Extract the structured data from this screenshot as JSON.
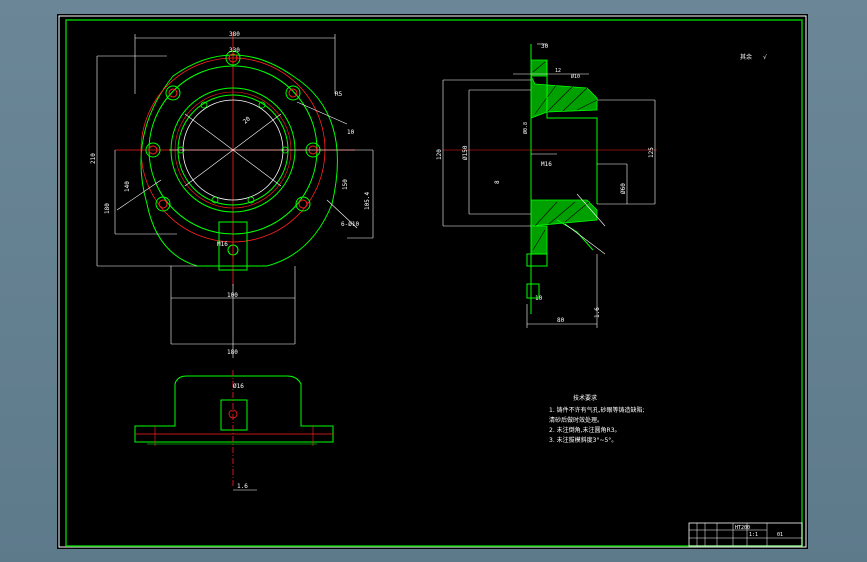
{
  "sheet": {
    "colors": {
      "background": "#000000",
      "frame": "#ffffff",
      "border": "#00c000",
      "outline": "#00ff00",
      "center_line": "#ff2020",
      "dimension": "#ffffff",
      "hatch": "#00c000"
    }
  },
  "roughness": {
    "label": "其余",
    "symbol": "√"
  },
  "plan_view": {
    "dims": [
      "380",
      "330",
      "R5",
      "210",
      "180",
      "140",
      "10",
      "105.4",
      "M16",
      "20",
      "100",
      "150",
      "180",
      "6-Ø10"
    ]
  },
  "bottom_view": {
    "dims": [
      "Ø16",
      "1.6"
    ]
  },
  "section_view": {
    "dims": [
      "30",
      "12",
      "Ø10",
      "120",
      "Ø0.8",
      "Ø150",
      "125",
      "Ø60",
      "M16",
      "8",
      "80",
      "1.6",
      "10"
    ]
  },
  "technical_requirements": {
    "title": "技术要求",
    "items": [
      "1. 铸件不许有气孔,砂眼等铸造缺陷;",
      "   清砂后做时效处理。",
      "2. 未注倒角,未注圆角R3。",
      "3. 未注拔模斜度3°~5°。"
    ]
  },
  "title_block": {
    "material": "HT200",
    "scale": "1:1",
    "drawing_no": "01"
  }
}
